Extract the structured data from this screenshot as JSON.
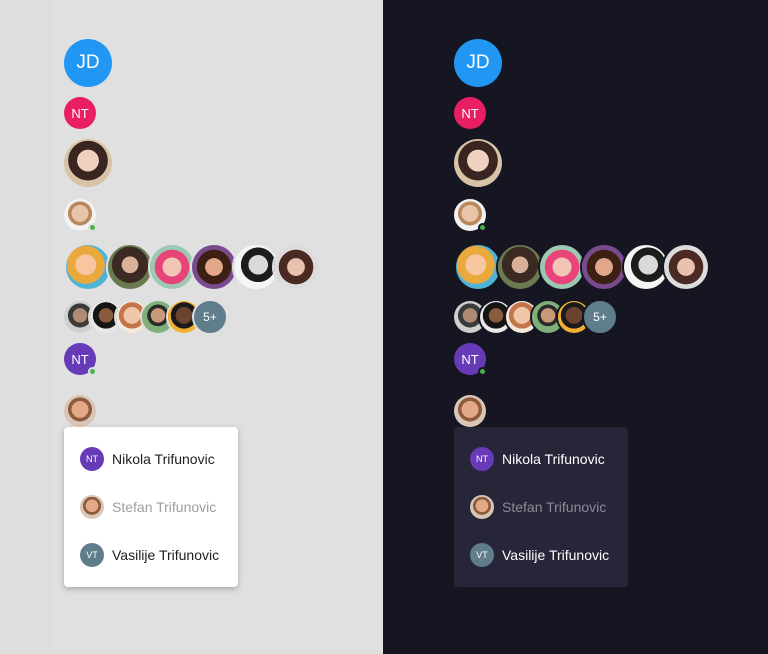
{
  "avatars": {
    "large_initials": "JD",
    "small_initials": "NT",
    "badge_initials": "NT",
    "overflow_count": "5+"
  },
  "menu": {
    "items": [
      {
        "initials": "NT",
        "label": "Nikola Trifunovic",
        "disabled": false
      },
      {
        "initials": "",
        "label": "Stefan Trifunovic",
        "disabled": true
      },
      {
        "initials": "VT",
        "label": "Vasilije Trifunovic",
        "disabled": false
      }
    ]
  },
  "themes": [
    "light",
    "dark"
  ],
  "colors": {
    "light_bg": "#e0e0e0",
    "dark_bg": "#161622",
    "blue": "#2196f3",
    "pink": "#e91e63",
    "purple": "#673ab7",
    "grey": "#607d8b",
    "online": "#4caf50"
  }
}
